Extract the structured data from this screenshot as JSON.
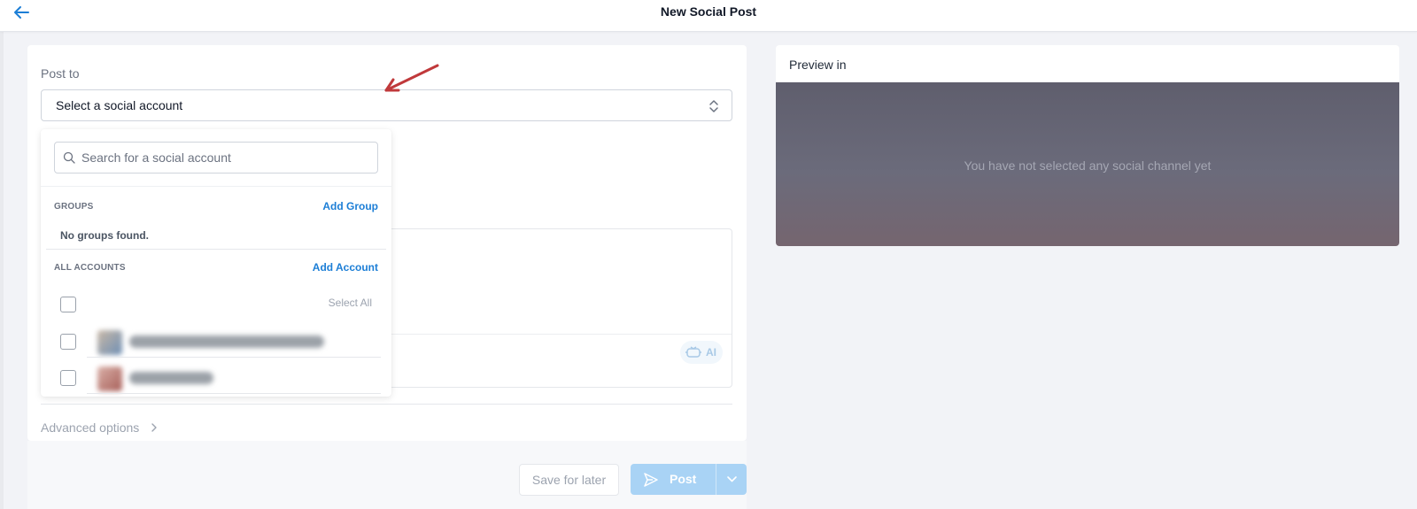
{
  "header": {
    "title": "New Social Post",
    "back_icon": "arrow-left-icon"
  },
  "composer": {
    "post_to_label": "Post to",
    "account_select_placeholder": "Select a social account",
    "ai_label": "AI",
    "advanced_options_label": "Advanced options"
  },
  "dropdown": {
    "search_placeholder": "Search for a social account",
    "groups_label": "GROUPS",
    "add_group_label": "Add Group",
    "no_groups_text": "No groups found.",
    "all_accounts_label": "ALL ACCOUNTS",
    "add_account_label": "Add Account",
    "select_all_label": "Select All"
  },
  "actions": {
    "save_later_label": "Save for later",
    "post_label": "Post"
  },
  "preview": {
    "label": "Preview in",
    "empty_text": "You have not selected any social channel yet"
  },
  "colors": {
    "accent": "#1c7ed6",
    "post_button": "#a9d3f5",
    "annotation_arrow": "#c0393b"
  }
}
